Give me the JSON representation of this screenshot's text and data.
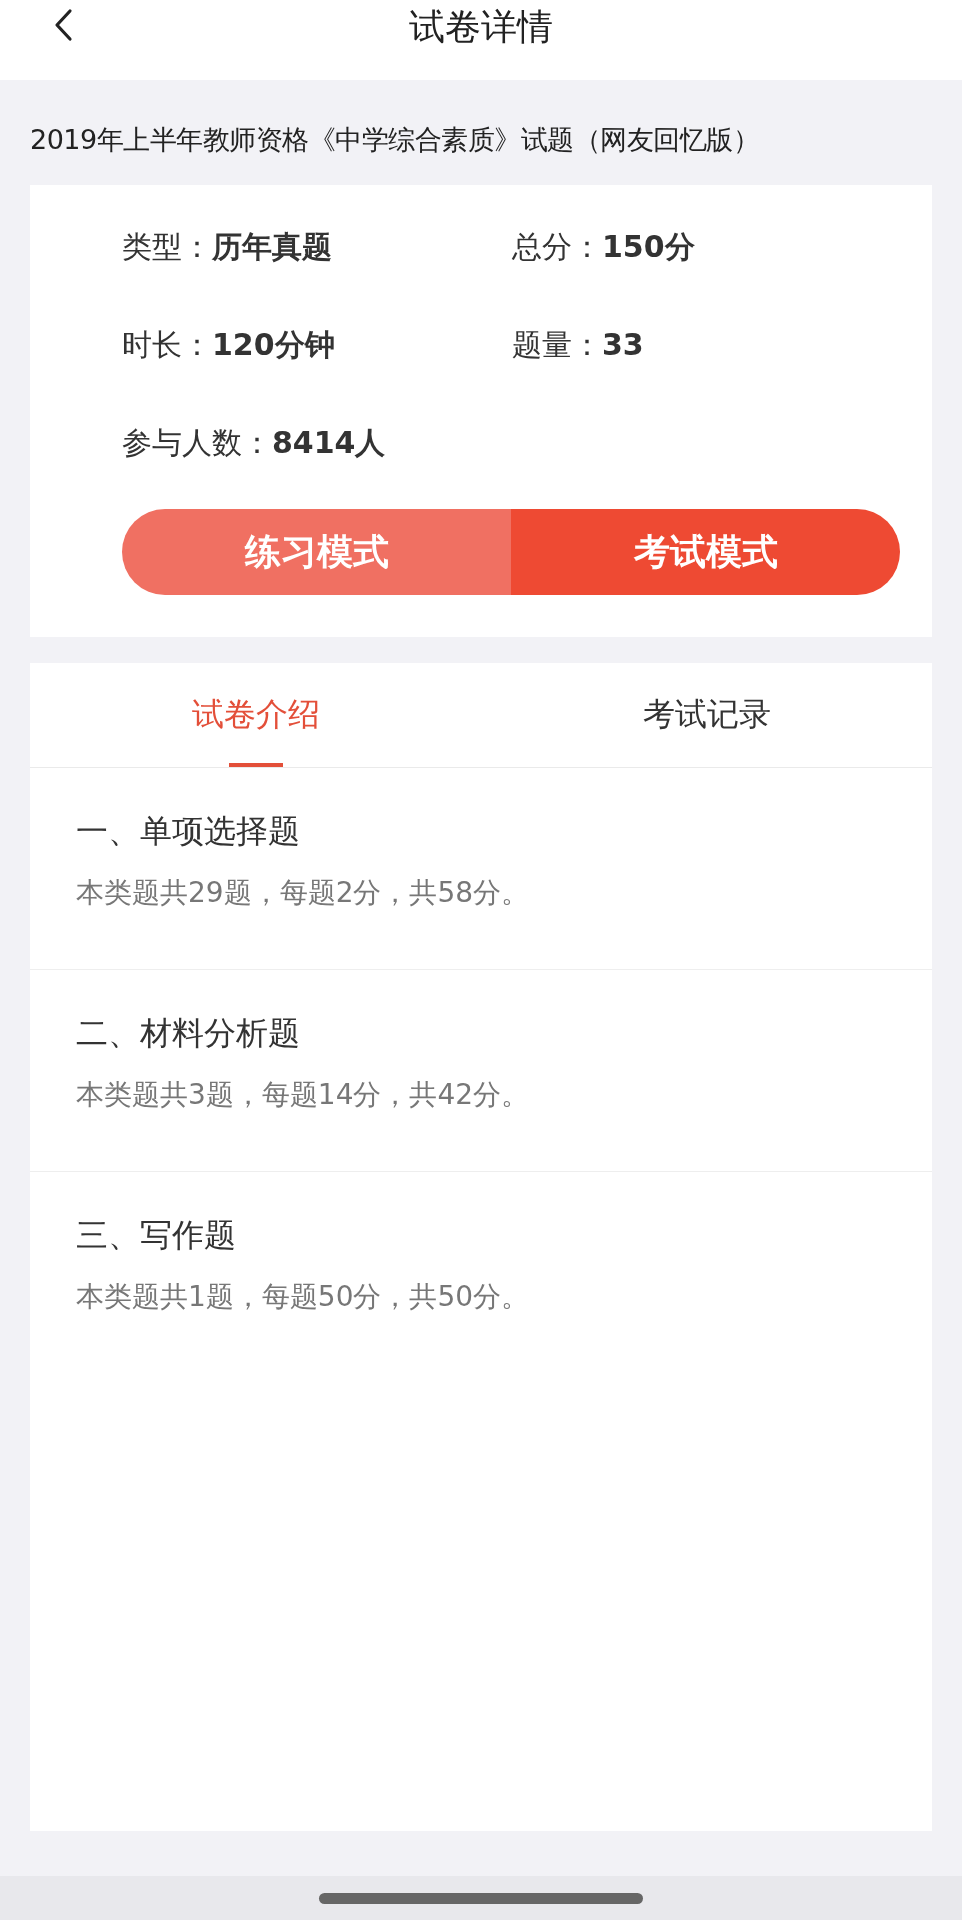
{
  "header": {
    "title": "试卷详情"
  },
  "paper_title": "2019年上半年教师资格《中学综合素质》试题（网友回忆版）",
  "info": [
    {
      "label": "类型：",
      "value": "历年真题"
    },
    {
      "label": "总分：",
      "value": "150分"
    },
    {
      "label": "时长：",
      "value": "120分钟"
    },
    {
      "label": "题量：",
      "value": "33"
    },
    {
      "label": "参与人数：",
      "value": "8414人"
    }
  ],
  "mode_buttons": [
    {
      "label": "练习模式",
      "kind": "practice"
    },
    {
      "label": "考试模式",
      "kind": "exam"
    }
  ],
  "tabs": [
    {
      "label": "试卷介绍",
      "selected": true
    },
    {
      "label": "考试记录",
      "selected": false
    }
  ],
  "sections": [
    {
      "heading": "一、单项选择题",
      "description": "本类题共29题，每题2分，共58分。"
    },
    {
      "heading": "二、材料分析题",
      "description": "本类题共3题，每题14分，共42分。"
    },
    {
      "heading": "三、写作题",
      "description": "本类题共1题，每题50分，共50分。"
    }
  ]
}
